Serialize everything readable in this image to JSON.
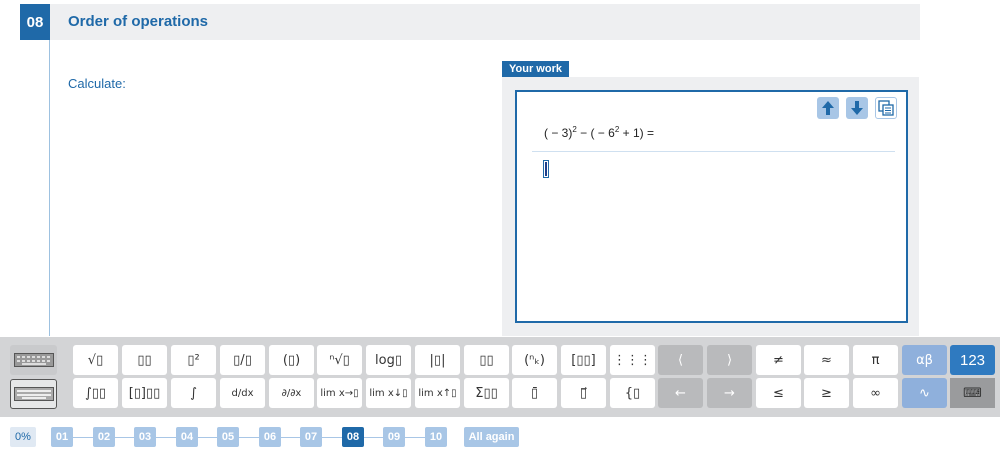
{
  "question": {
    "number": "08",
    "title": "Order of operations",
    "prompt": "Calculate:"
  },
  "work": {
    "tab_label": "Your work",
    "expression": {
      "part1": "( − 3)",
      "exp1": "2",
      "part2": " − ( − 6",
      "exp2": "2",
      "part3": " + 1) ="
    }
  },
  "keyboard": {
    "row1": [
      "√▯",
      "▯▯",
      "▯²",
      "▯/▯",
      "(▯)",
      "ⁿ√▯",
      "log▯",
      "|▯|",
      "▯▯",
      "(ⁿₖ)",
      "[▯▯]",
      "⋮⋮⋮",
      "⟨",
      "⟩",
      "≠",
      "≈",
      "π",
      "αβ",
      "123"
    ],
    "row2": [
      "∫▯▯",
      "[▯]▯▯",
      "∫",
      "d/dx",
      "∂/∂x",
      "lim x→▯",
      "lim x↓▯",
      "lim x↑▯",
      "Σ▯▯",
      "▯̄",
      "▯⃗",
      "{▯",
      "←",
      "→",
      "≤",
      "≥",
      "∞",
      "∿",
      "⌨"
    ]
  },
  "navigation": {
    "progress": "0%",
    "steps": [
      "01",
      "02",
      "03",
      "04",
      "05",
      "06",
      "07",
      "08",
      "09",
      "10"
    ],
    "current": "08",
    "again_label": "All again"
  }
}
